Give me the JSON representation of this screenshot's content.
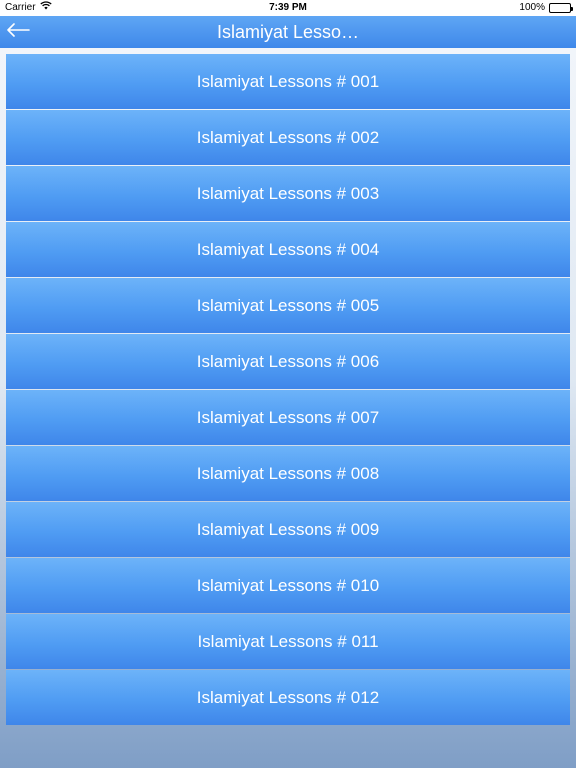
{
  "status_bar": {
    "carrier": "Carrier",
    "time": "7:39 PM",
    "battery": "100%",
    "icons": [
      "wifi-icon",
      "battery-icon"
    ]
  },
  "nav": {
    "back_icon": "back-arrow-icon",
    "title": "Islamiyat Lesso…"
  },
  "lessons": [
    "Islamiyat Lessons # 001",
    "Islamiyat Lessons # 002",
    "Islamiyat Lessons # 003",
    "Islamiyat Lessons # 004",
    "Islamiyat Lessons # 005",
    "Islamiyat Lessons # 006",
    "Islamiyat Lessons # 007",
    "Islamiyat Lessons # 008",
    "Islamiyat Lessons # 009",
    "Islamiyat Lessons # 010",
    "Islamiyat Lessons # 011",
    "Islamiyat Lessons # 012"
  ],
  "colors": {
    "nav_top": "#5fa6f4",
    "nav_bottom": "#3e88ea",
    "button_top": "#6db3f9",
    "button_bottom": "#3f86ea",
    "text": "#ffffff"
  }
}
